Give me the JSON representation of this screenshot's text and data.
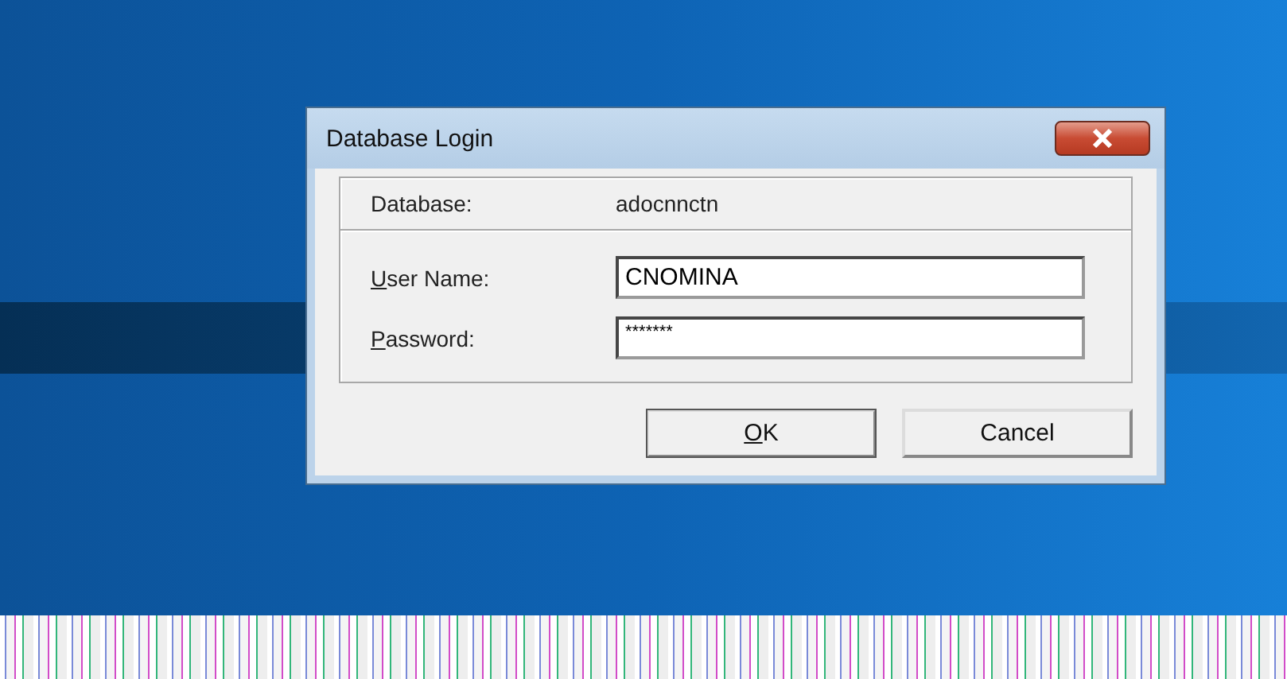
{
  "window": {
    "title": "Database Login"
  },
  "database": {
    "label": "Database:",
    "value": "adocnnctn"
  },
  "fields": [
    {
      "mnemonic": "U",
      "rest": "ser Name:",
      "value": "CNOMINA",
      "kind": "text"
    },
    {
      "mnemonic": "P",
      "rest": "assword:",
      "value": "*******",
      "kind": "password"
    }
  ],
  "buttons": [
    {
      "mnemonic": "O",
      "rest": "K",
      "default": true
    },
    {
      "rest": "Cancel",
      "default": false
    }
  ]
}
